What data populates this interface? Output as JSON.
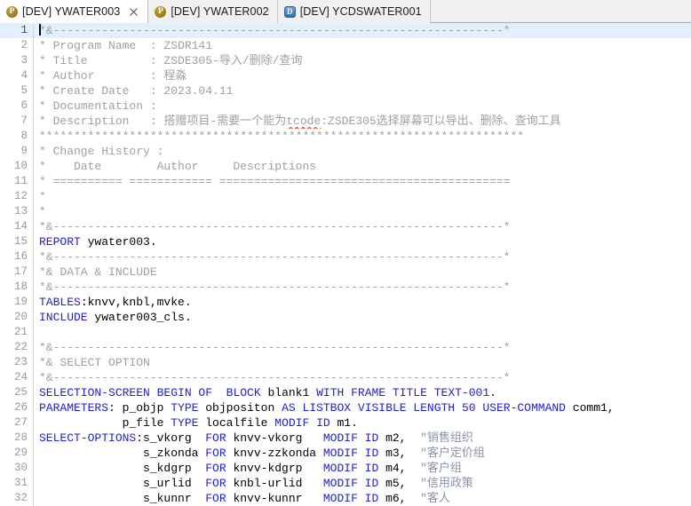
{
  "window": {
    "title": "ABAP Editor",
    "accent_color": "#2222cc",
    "comment_color": "#a0a0a0",
    "current_line_highlight": "#e3effc"
  },
  "tabbar": {
    "tabs": [
      {
        "icon": "program-icon",
        "icon_letter": "P",
        "label": "[DEV] YWATER003",
        "active": true,
        "closable": true
      },
      {
        "icon": "program-icon",
        "icon_letter": "P",
        "label": "[DEV] YWATER002",
        "active": false,
        "closable": false
      },
      {
        "icon": "ddic-icon",
        "icon_letter": "D",
        "label": "[DEV] YCDSWATER001",
        "active": false,
        "closable": false
      }
    ],
    "close_icon_name": "close-icon"
  },
  "editor": {
    "current_line": 1,
    "first_line": 1,
    "last_line": 32,
    "lines": [
      {
        "n": 1,
        "cursor": true,
        "tokens": [
          {
            "t": "*&-----------------------------------------------------------------*",
            "c": "cm"
          }
        ]
      },
      {
        "n": 2,
        "tokens": [
          {
            "t": "* Program Name  : ZSDR141",
            "c": "cm"
          }
        ]
      },
      {
        "n": 3,
        "tokens": [
          {
            "t": "* Title         : ZSDE305-导入/删除/查询",
            "c": "cm"
          }
        ]
      },
      {
        "n": 4,
        "tokens": [
          {
            "t": "* Author        : 程淼",
            "c": "cm"
          }
        ]
      },
      {
        "n": 5,
        "tokens": [
          {
            "t": "* Create Date   : 2023.04.11",
            "c": "cm"
          }
        ]
      },
      {
        "n": 6,
        "tokens": [
          {
            "t": "* Documentation :",
            "c": "cm"
          }
        ]
      },
      {
        "n": 7,
        "tokens": [
          {
            "t": "* Description   : 搭赠项目-需要一个能为",
            "c": "cm"
          },
          {
            "t": "tcode",
            "c": "cm sq"
          },
          {
            "t": ":ZSDE305选择屏幕可以导出、删除、查询工具",
            "c": "cm"
          }
        ]
      },
      {
        "n": 8,
        "tokens": [
          {
            "t": "**********************************************************************",
            "c": "cm"
          }
        ]
      },
      {
        "n": 9,
        "tokens": [
          {
            "t": "* Change History :",
            "c": "cm"
          }
        ]
      },
      {
        "n": 10,
        "tokens": [
          {
            "t": "*    Date        Author     Descriptions",
            "c": "cm"
          }
        ]
      },
      {
        "n": 11,
        "tokens": [
          {
            "t": "* ========== ============ ==========================================",
            "c": "cm"
          }
        ]
      },
      {
        "n": 12,
        "tokens": [
          {
            "t": "*",
            "c": "cm"
          }
        ]
      },
      {
        "n": 13,
        "tokens": [
          {
            "t": "*",
            "c": "cm"
          }
        ]
      },
      {
        "n": 14,
        "tokens": [
          {
            "t": "*&-----------------------------------------------------------------*",
            "c": "cm"
          }
        ]
      },
      {
        "n": 15,
        "tokens": [
          {
            "t": "REPORT",
            "c": "kw"
          },
          {
            "t": " ywater003.",
            "c": "pl"
          }
        ]
      },
      {
        "n": 16,
        "tokens": [
          {
            "t": "*&-----------------------------------------------------------------*",
            "c": "cm"
          }
        ]
      },
      {
        "n": 17,
        "tokens": [
          {
            "t": "*& DATA & INCLUDE",
            "c": "cm"
          }
        ]
      },
      {
        "n": 18,
        "tokens": [
          {
            "t": "*&-----------------------------------------------------------------*",
            "c": "cm"
          }
        ]
      },
      {
        "n": 19,
        "tokens": [
          {
            "t": "TABLES",
            "c": "kw"
          },
          {
            "t": ":knvv,knbl,mvke.",
            "c": "pl"
          }
        ]
      },
      {
        "n": 20,
        "tokens": [
          {
            "t": "INCLUDE",
            "c": "kw"
          },
          {
            "t": " ywater003_cls.",
            "c": "pl"
          }
        ]
      },
      {
        "n": 21,
        "tokens": [
          {
            "t": "",
            "c": "pl"
          }
        ]
      },
      {
        "n": 22,
        "tokens": [
          {
            "t": "*&-----------------------------------------------------------------*",
            "c": "cm"
          }
        ]
      },
      {
        "n": 23,
        "tokens": [
          {
            "t": "*& SELECT OPTION",
            "c": "cm"
          }
        ]
      },
      {
        "n": 24,
        "tokens": [
          {
            "t": "*&-----------------------------------------------------------------*",
            "c": "cm"
          }
        ]
      },
      {
        "n": 25,
        "tokens": [
          {
            "t": "SELECTION-SCREEN BEGIN OF ",
            "c": "kw"
          },
          {
            "t": " ",
            "c": "pl"
          },
          {
            "t": "BLOCK",
            "c": "kw"
          },
          {
            "t": " blank1 ",
            "c": "pl"
          },
          {
            "t": "WITH FRAME TITLE TEXT-",
            "c": "kw"
          },
          {
            "t": "001",
            "c": "num"
          },
          {
            "t": ".",
            "c": "pl"
          }
        ]
      },
      {
        "n": 26,
        "tokens": [
          {
            "t": "PARAMETERS",
            "c": "kw"
          },
          {
            "t": ": p_objp ",
            "c": "pl"
          },
          {
            "t": "TYPE",
            "c": "kw"
          },
          {
            "t": " objpositon ",
            "c": "pl"
          },
          {
            "t": "AS LISTBOX VISIBLE LENGTH",
            "c": "kw"
          },
          {
            "t": " ",
            "c": "pl"
          },
          {
            "t": "50",
            "c": "num"
          },
          {
            "t": " ",
            "c": "pl"
          },
          {
            "t": "USER-COMMAND",
            "c": "kw"
          },
          {
            "t": " comm1,",
            "c": "pl"
          }
        ]
      },
      {
        "n": 27,
        "tokens": [
          {
            "t": "            p_file ",
            "c": "pl"
          },
          {
            "t": "TYPE",
            "c": "kw"
          },
          {
            "t": " localfile ",
            "c": "pl"
          },
          {
            "t": "MODIF ID",
            "c": "kw"
          },
          {
            "t": " m1.",
            "c": "pl"
          }
        ]
      },
      {
        "n": 28,
        "tokens": [
          {
            "t": "SELECT-OPTIONS",
            "c": "kw"
          },
          {
            "t": ":s_vkorg  ",
            "c": "pl"
          },
          {
            "t": "FOR",
            "c": "kw"
          },
          {
            "t": " knvv-vkorg   ",
            "c": "pl"
          },
          {
            "t": "MODIF ID",
            "c": "kw"
          },
          {
            "t": " m2,  ",
            "c": "pl"
          },
          {
            "t": "\"销售组织",
            "c": "cmb"
          }
        ]
      },
      {
        "n": 29,
        "tokens": [
          {
            "t": "               s_zkonda ",
            "c": "pl"
          },
          {
            "t": "FOR",
            "c": "kw"
          },
          {
            "t": " knvv-zzkonda ",
            "c": "pl"
          },
          {
            "t": "MODIF ID",
            "c": "kw"
          },
          {
            "t": " m3,  ",
            "c": "pl"
          },
          {
            "t": "\"客户定价组",
            "c": "cmb"
          }
        ]
      },
      {
        "n": 30,
        "tokens": [
          {
            "t": "               s_kdgrp  ",
            "c": "pl"
          },
          {
            "t": "FOR",
            "c": "kw"
          },
          {
            "t": " knvv-kdgrp   ",
            "c": "pl"
          },
          {
            "t": "MODIF ID",
            "c": "kw"
          },
          {
            "t": " m4,  ",
            "c": "pl"
          },
          {
            "t": "\"客户组",
            "c": "cmb"
          }
        ]
      },
      {
        "n": 31,
        "tokens": [
          {
            "t": "               s_urlid  ",
            "c": "pl"
          },
          {
            "t": "FOR",
            "c": "kw"
          },
          {
            "t": " knbl-urlid   ",
            "c": "pl"
          },
          {
            "t": "MODIF ID",
            "c": "kw"
          },
          {
            "t": " m5,  ",
            "c": "pl"
          },
          {
            "t": "\"信用政策",
            "c": "cmb"
          }
        ]
      },
      {
        "n": 32,
        "tokens": [
          {
            "t": "               s_kunnr  ",
            "c": "pl"
          },
          {
            "t": "FOR",
            "c": "kw"
          },
          {
            "t": " knvv-kunnr   ",
            "c": "pl"
          },
          {
            "t": "MODIF ID",
            "c": "kw"
          },
          {
            "t": " m6,  ",
            "c": "pl"
          },
          {
            "t": "\"客人",
            "c": "cmb"
          }
        ]
      }
    ]
  }
}
